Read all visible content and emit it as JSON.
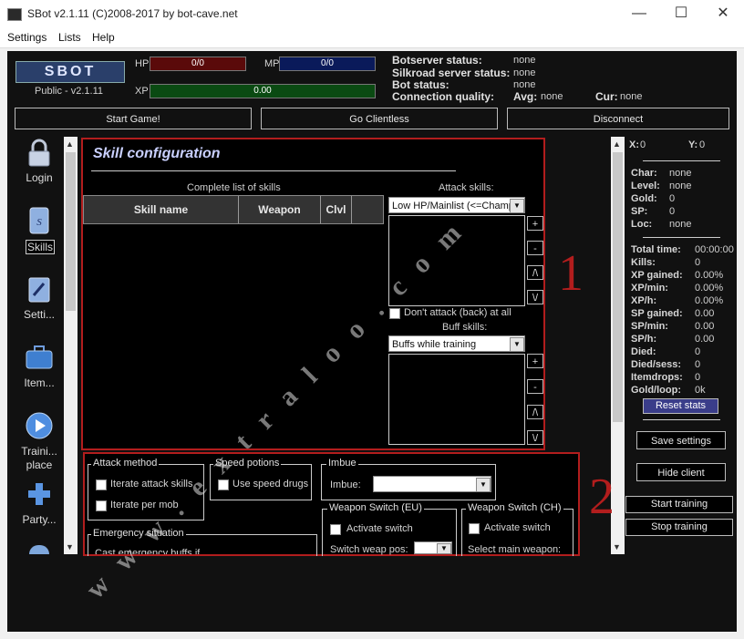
{
  "window": {
    "title": "SBot v2.1.11 (C)2008-2017 by bot-cave.net",
    "controls": {
      "minimize": "—",
      "maximize": "☐",
      "close": "✕"
    }
  },
  "menu": [
    "Settings",
    "Lists",
    "Help"
  ],
  "header": {
    "logo_text": "SBOT",
    "version": "Public - v2.1.11",
    "hp": {
      "label": "HP",
      "value": "0/0"
    },
    "mp": {
      "label": "MP",
      "value": "0/0"
    },
    "xp": {
      "label": "XP",
      "value": "0.00"
    },
    "status": [
      {
        "label": "Botserver status:",
        "value": "none"
      },
      {
        "label": "Silkroad server status:",
        "value": "none"
      },
      {
        "label": "Bot status:",
        "value": "none"
      }
    ],
    "connection": {
      "label": "Connection quality:",
      "avg_label": "Avg:",
      "avg": "none",
      "cur_label": "Cur:",
      "cur": "none"
    }
  },
  "actions": {
    "start_game": "Start Game!",
    "go_clientless": "Go Clientless",
    "disconnect": "Disconnect"
  },
  "sidebar": [
    {
      "label": "Login",
      "icon": "lock-icon"
    },
    {
      "label": "Skills",
      "icon": "skills-book-icon"
    },
    {
      "label": "Setti...",
      "icon": "settings-doc-icon"
    },
    {
      "label": "Item...",
      "icon": "briefcase-icon"
    },
    {
      "label": "Traini... place",
      "icon": "play-icon"
    },
    {
      "label": "Party...",
      "icon": "plus-icon"
    }
  ],
  "skills": {
    "title": "Skill configuration",
    "complete_list_title": "Complete list of skills",
    "columns": [
      "Skill name",
      "Weapon",
      "Clvl"
    ],
    "attack_title": "Attack skills:",
    "attack_mode": "Low HP/Mainlist (<=Champ",
    "dont_attack_back": "Don't attack (back) at all",
    "buff_title": "Buff skills:",
    "buff_mode": "Buffs while training",
    "list_buttons": [
      "+",
      "-",
      "/\\",
      "\\/"
    ]
  },
  "lower": {
    "attack_method": {
      "title": "Attack method",
      "options": [
        "Iterate attack skills",
        "Iterate per mob"
      ]
    },
    "speed_potions": {
      "title": "Speed potions",
      "option": "Use speed drugs"
    },
    "imbue": {
      "title": "Imbue",
      "label": "Imbue:"
    },
    "emergency": {
      "title": "Emergency situation",
      "text": "Cast emergency buffs if"
    },
    "weapon_switch_eu": {
      "title": "Weapon Switch (EU)",
      "option": "Activate switch",
      "label": "Switch weap pos:"
    },
    "weapon_switch_ch": {
      "title": "Weapon Switch (CH)",
      "option": "Activate switch",
      "label": "Select main weapon:"
    }
  },
  "right_panel": {
    "coords": {
      "x_label": "X:",
      "x": "0",
      "y_label": "Y:",
      "y": "0"
    },
    "char": [
      {
        "label": "Char:",
        "value": "none"
      },
      {
        "label": "Level:",
        "value": "none"
      },
      {
        "label": "Gold:",
        "value": "0"
      },
      {
        "label": "SP:",
        "value": "0"
      },
      {
        "label": "Loc:",
        "value": "none"
      }
    ],
    "stats": [
      {
        "label": "Total time:",
        "value": "00:00:00"
      },
      {
        "label": "Kills:",
        "value": "0"
      },
      {
        "label": "XP gained:",
        "value": "0.00%"
      },
      {
        "label": "XP/min:",
        "value": "0.00%"
      },
      {
        "label": "XP/h:",
        "value": "0.00%"
      },
      {
        "label": "SP gained:",
        "value": "0.00"
      },
      {
        "label": "SP/min:",
        "value": "0.00"
      },
      {
        "label": "SP/h:",
        "value": "0.00"
      },
      {
        "label": "Died:",
        "value": "0"
      },
      {
        "label": "Died/sess:",
        "value": "0"
      },
      {
        "label": "Itemdrops:",
        "value": "0"
      },
      {
        "label": "Gold/loop:",
        "value": "0k"
      }
    ],
    "reset_stats": "Reset stats",
    "save_settings": "Save settings",
    "hide_client": "Hide client",
    "start_training": "Start training",
    "stop_training": "Stop training"
  },
  "annotations": {
    "mark_1": "1",
    "mark_2": "2",
    "watermark": "www.extraloo.com"
  },
  "colors": {
    "highlight_border": "#b21d1d",
    "hp_bar": "#5a0a0a",
    "mp_bar": "#0a1a5a",
    "xp_bar": "#0a4a12",
    "reset_button": "#3a3d8a"
  }
}
